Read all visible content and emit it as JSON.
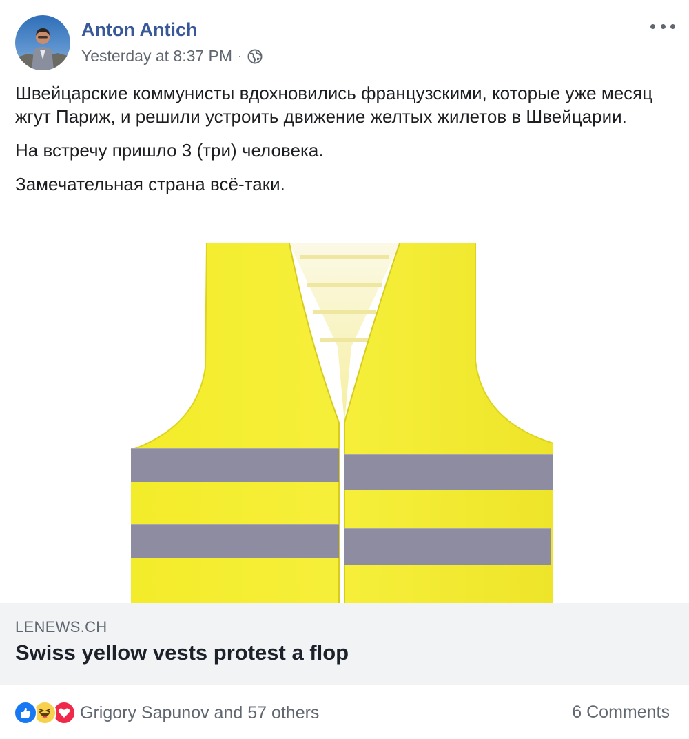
{
  "post": {
    "author": "Anton Antich",
    "timestamp": "Yesterday at 8:37 PM",
    "separator": "·",
    "privacy_icon": "globe-icon",
    "paragraphs": [
      "Швейцарские коммунисты вдохновились французскими, которые уже месяц жгут Париж, и решили устроить движение желтых жилетов в Швейцарии.",
      "На встречу пришло 3 (три) человека.",
      "Замечательная страна всё-таки."
    ]
  },
  "link_card": {
    "domain": "LENEWS.CH",
    "title": "Swiss yellow vests protest a flop"
  },
  "footer": {
    "reaction_icons": [
      "like-icon",
      "haha-icon",
      "love-icon"
    ],
    "reactions_text": "Grigory Sapunov and 57 others",
    "comments_text": "6 Comments"
  },
  "colors": {
    "author_link": "#385898",
    "meta_gray": "#616770",
    "card_bg": "#f2f3f5",
    "vest_yellow": "#f4ee2c",
    "reflective_stripe": "#8e8ca0"
  }
}
